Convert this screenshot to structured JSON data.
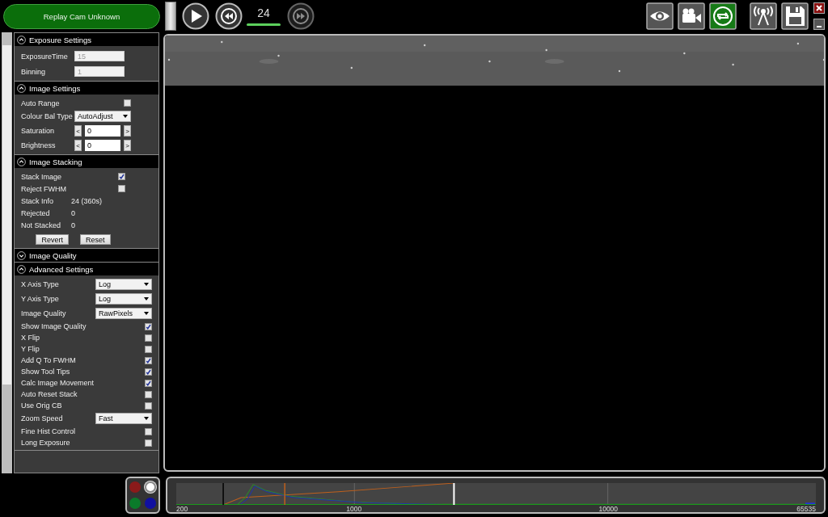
{
  "toolbar": {
    "source_button": "Replay Cam Unknown",
    "frame_count": "24",
    "forward_disabled": true,
    "tool_buttons": [
      {
        "active": false
      },
      {
        "active": false
      },
      {
        "active": true
      },
      {
        "active": false
      },
      {
        "active": false
      }
    ]
  },
  "sections": [
    {
      "title": "Exposure Settings",
      "expanded": true,
      "rows": [
        {
          "kind": "field",
          "label": "ExposureTime",
          "value": "15",
          "disabled": true
        },
        {
          "kind": "field",
          "label": "Binning",
          "value": "1",
          "disabled": true
        }
      ]
    },
    {
      "title": "Image Settings",
      "expanded": true,
      "rows": [
        {
          "kind": "checkbox",
          "label": "Auto Range",
          "checked": false
        },
        {
          "kind": "dropdown",
          "label": "Colour Bal Type",
          "value": "AutoAdjust"
        },
        {
          "kind": "stepper",
          "label": "Saturation",
          "value": "0",
          "dec": "<",
          "inc": ">"
        },
        {
          "kind": "stepper",
          "label": "Brightness",
          "value": "0",
          "dec": "<",
          "inc": ">"
        }
      ]
    },
    {
      "title": "Image Stacking",
      "expanded": true,
      "rows": [
        {
          "kind": "checkbox",
          "label": "Stack Image",
          "checked": true
        },
        {
          "kind": "checkbox",
          "label": "Reject FWHM",
          "checked": false
        },
        {
          "kind": "info",
          "label": "Stack Info",
          "value": "24 (360s)"
        },
        {
          "kind": "info",
          "label": "Rejected",
          "value": "0"
        },
        {
          "kind": "info",
          "label": "Not Stacked",
          "value": "0"
        },
        {
          "kind": "buttons",
          "buttons": [
            "Revert",
            "Reset"
          ]
        }
      ]
    },
    {
      "title": "Image Quality",
      "expanded": false
    },
    {
      "title": "Advanced Settings",
      "expanded": true,
      "rows": [
        {
          "kind": "dropdown",
          "label": "X Axis Type",
          "value": "Log"
        },
        {
          "kind": "dropdown",
          "label": "Y Axis Type",
          "value": "Log"
        },
        {
          "kind": "dropdown",
          "label": "Image Quality",
          "value": "RawPixels"
        },
        {
          "kind": "checkbox",
          "label": "Show Image Quality",
          "checked": true
        },
        {
          "kind": "checkbox",
          "label": "X Flip",
          "checked": false
        },
        {
          "kind": "checkbox",
          "label": "Y Flip",
          "checked": false
        },
        {
          "kind": "checkbox",
          "label": "Add Q To FWHM",
          "checked": true
        },
        {
          "kind": "checkbox",
          "label": "Show Tool Tips",
          "checked": true
        },
        {
          "kind": "checkbox",
          "label": "Calc Image Movement",
          "checked": true
        },
        {
          "kind": "checkbox",
          "label": "Auto Reset Stack",
          "checked": false
        },
        {
          "kind": "checkbox",
          "label": "Use Orig CB",
          "checked": false
        },
        {
          "kind": "dropdown",
          "label": "Zoom Speed",
          "value": "Fast"
        },
        {
          "kind": "checkbox",
          "label": "Fine Hist Control",
          "checked": false
        },
        {
          "kind": "checkbox",
          "label": "Long Exposure",
          "checked": false
        }
      ]
    }
  ],
  "channels": [
    {
      "color": "#8b1a1a",
      "selected": false
    },
    {
      "color": "#ffffff",
      "selected": true
    },
    {
      "color": "#0a7a2a",
      "selected": false
    },
    {
      "color": "#1010a0",
      "selected": false
    }
  ],
  "histogram": {
    "axis_labels": [
      "200",
      "1000",
      "10000",
      "65535"
    ]
  }
}
